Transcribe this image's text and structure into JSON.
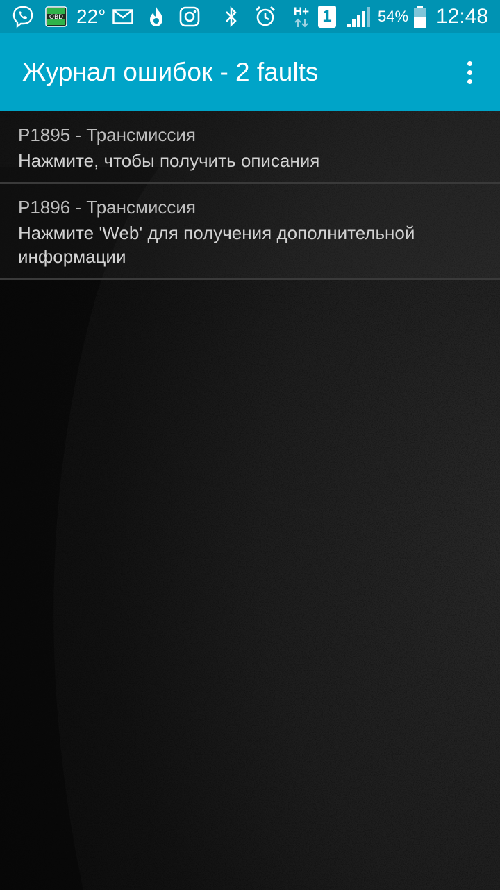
{
  "status_bar": {
    "temperature": "22°",
    "battery_percent": "54%",
    "sim_slot": "1",
    "network_type": "H+",
    "time": "12:48",
    "obd_label": "OBD",
    "icons": [
      "viber-icon",
      "obd-icon",
      "mail-icon",
      "fire-icon",
      "instagram-icon",
      "bluetooth-icon",
      "alarm-icon",
      "data-arrows-icon",
      "signal-icon",
      "battery-icon"
    ],
    "battery_level": 0.54
  },
  "toolbar": {
    "title": "Журнал ошибок - 2 faults",
    "menu_icon": "more-vert-icon"
  },
  "faults": [
    {
      "code": "P1895 - Трансмиссия",
      "hint": "Нажмите, чтобы получить описания"
    },
    {
      "code": "P1896 - Трансмиссия",
      "hint": "Нажмите 'Web' для получения дополнительной информации"
    }
  ],
  "colors": {
    "status_bar": "#0093b3",
    "toolbar": "#00a4c8",
    "background": "#0d0d0d",
    "text_primary": "#d2d2d2",
    "text_secondary": "#bdbdbd"
  }
}
